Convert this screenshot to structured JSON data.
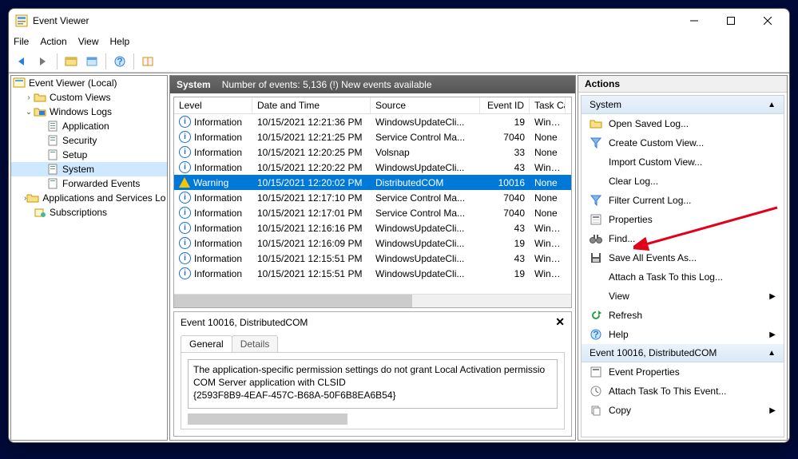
{
  "window": {
    "title": "Event Viewer"
  },
  "menu": {
    "file": "File",
    "action": "Action",
    "view": "View",
    "help": "Help"
  },
  "tree": {
    "root": "Event Viewer (Local)",
    "custom_views": "Custom Views",
    "windows_logs": "Windows Logs",
    "application": "Application",
    "security": "Security",
    "setup": "Setup",
    "system": "System",
    "forwarded": "Forwarded Events",
    "apps_services": "Applications and Services Lo",
    "subscriptions": "Subscriptions"
  },
  "center_header": {
    "title": "System",
    "count_label": "Number of events: 5,136 (!) New events available"
  },
  "columns": {
    "level": "Level",
    "date": "Date and Time",
    "source": "Source",
    "eventid": "Event ID",
    "task": "Task Ca"
  },
  "rows": [
    {
      "level": "Information",
      "type": "info",
      "date": "10/15/2021 12:21:36 PM",
      "source": "WindowsUpdateCli...",
      "eventid": "19",
      "task": "Windo"
    },
    {
      "level": "Information",
      "type": "info",
      "date": "10/15/2021 12:21:25 PM",
      "source": "Service Control Ma...",
      "eventid": "7040",
      "task": "None"
    },
    {
      "level": "Information",
      "type": "info",
      "date": "10/15/2021 12:20:25 PM",
      "source": "Volsnap",
      "eventid": "33",
      "task": "None"
    },
    {
      "level": "Information",
      "type": "info",
      "date": "10/15/2021 12:20:22 PM",
      "source": "WindowsUpdateCli...",
      "eventid": "43",
      "task": "Windo"
    },
    {
      "level": "Warning",
      "type": "warn",
      "date": "10/15/2021 12:20:02 PM",
      "source": "DistributedCOM",
      "eventid": "10016",
      "task": "None",
      "selected": true
    },
    {
      "level": "Information",
      "type": "info",
      "date": "10/15/2021 12:17:10 PM",
      "source": "Service Control Ma...",
      "eventid": "7040",
      "task": "None"
    },
    {
      "level": "Information",
      "type": "info",
      "date": "10/15/2021 12:17:01 PM",
      "source": "Service Control Ma...",
      "eventid": "7040",
      "task": "None"
    },
    {
      "level": "Information",
      "type": "info",
      "date": "10/15/2021 12:16:16 PM",
      "source": "WindowsUpdateCli...",
      "eventid": "43",
      "task": "Windo"
    },
    {
      "level": "Information",
      "type": "info",
      "date": "10/15/2021 12:16:09 PM",
      "source": "WindowsUpdateCli...",
      "eventid": "19",
      "task": "Windo"
    },
    {
      "level": "Information",
      "type": "info",
      "date": "10/15/2021 12:15:51 PM",
      "source": "WindowsUpdateCli...",
      "eventid": "43",
      "task": "Windo"
    },
    {
      "level": "Information",
      "type": "info",
      "date": "10/15/2021 12:15:51 PM",
      "source": "WindowsUpdateCli...",
      "eventid": "19",
      "task": "Windo"
    }
  ],
  "detail": {
    "title": "Event 10016, DistributedCOM",
    "tab_general": "General",
    "tab_details": "Details",
    "line1": "The application-specific permission settings do not grant Local Activation permissio",
    "line2": "COM Server application with CLSID",
    "line3": "{2593F8B9-4EAF-457C-B68A-50F6B8EA6B54}"
  },
  "actions": {
    "panel_title": "Actions",
    "section_system": "System",
    "open_saved": "Open Saved Log...",
    "create_custom": "Create Custom View...",
    "import_custom": "Import Custom View...",
    "clear_log": "Clear Log...",
    "filter_current": "Filter Current Log...",
    "properties": "Properties",
    "find": "Find...",
    "save_all": "Save All Events As...",
    "attach_task_log": "Attach a Task To this Log...",
    "view": "View",
    "refresh": "Refresh",
    "help": "Help",
    "section_event": "Event 10016, DistributedCOM",
    "event_properties": "Event Properties",
    "attach_task_event": "Attach Task To This Event...",
    "copy": "Copy"
  }
}
